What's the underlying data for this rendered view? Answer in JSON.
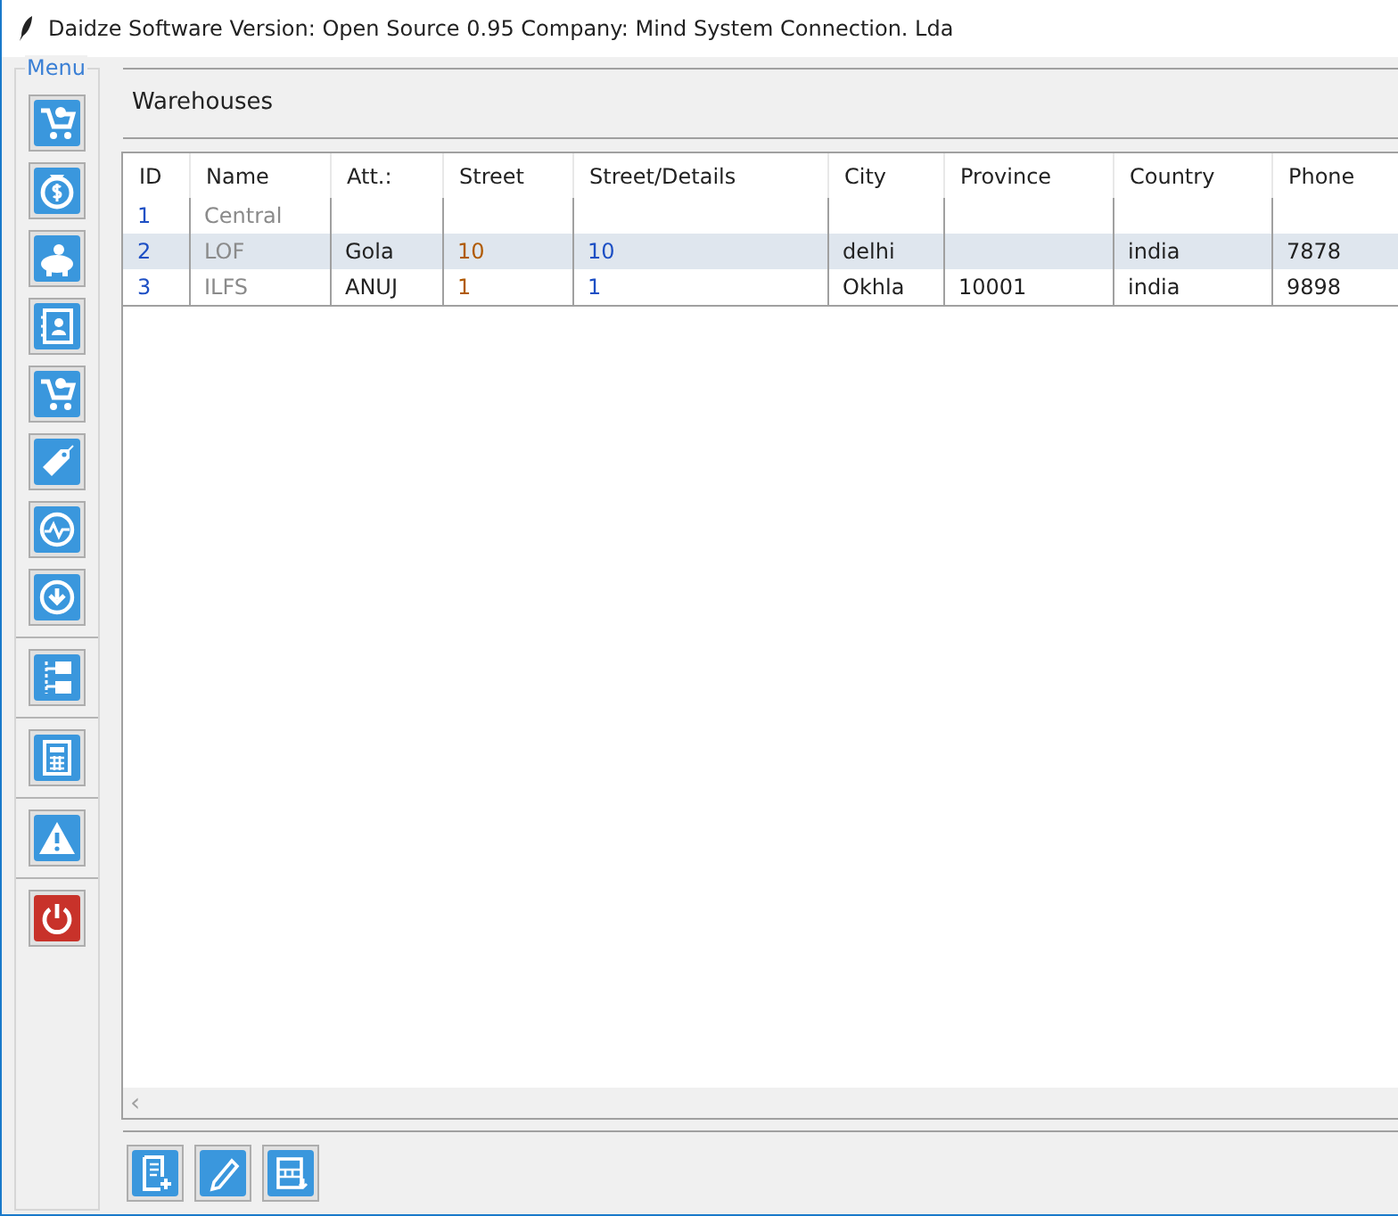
{
  "window": {
    "title": "Daidze Software Version: Open Source 0.95 Company: Mind System Connection. Lda"
  },
  "sidebar": {
    "legend": "Menu",
    "groups": [
      {
        "buttons": [
          {
            "kind": "cart"
          },
          {
            "kind": "money"
          },
          {
            "kind": "piggy"
          },
          {
            "kind": "contacts"
          },
          {
            "kind": "cart"
          },
          {
            "kind": "tag"
          },
          {
            "kind": "pulse"
          },
          {
            "kind": "download"
          }
        ]
      },
      {
        "buttons": [
          {
            "kind": "tree"
          }
        ]
      },
      {
        "buttons": [
          {
            "kind": "calculator"
          }
        ]
      },
      {
        "buttons": [
          {
            "kind": "warning"
          }
        ]
      },
      {
        "buttons": [
          {
            "kind": "power"
          }
        ]
      }
    ]
  },
  "panel": {
    "title": "Warehouses"
  },
  "table": {
    "columns": [
      "ID",
      "Name",
      "Att.:",
      "Street",
      "Street/Details",
      "City",
      "Province",
      "Country",
      "Phone"
    ],
    "rows": [
      {
        "selected": false,
        "cells": [
          "1",
          "Central",
          "",
          "",
          "",
          "",
          "",
          "",
          ""
        ]
      },
      {
        "selected": true,
        "cells": [
          "2",
          "LOF",
          "Gola",
          "10",
          "10",
          "delhi",
          "",
          "india",
          "7878"
        ]
      },
      {
        "selected": false,
        "cells": [
          "3",
          "ILFS",
          "ANUJ",
          "1",
          "1",
          "Okhla",
          "10001",
          "india",
          "9898"
        ]
      }
    ],
    "scroll_left": "‹"
  },
  "actions": [
    {
      "kind": "new"
    },
    {
      "kind": "edit"
    },
    {
      "kind": "export"
    }
  ]
}
